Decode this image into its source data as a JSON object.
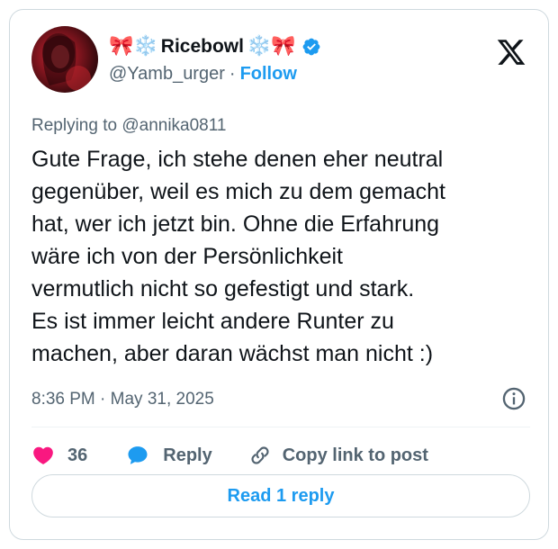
{
  "author": {
    "name_prefix": "🎀❄️",
    "name": "Ricebowl",
    "name_suffix": "❄️🎀",
    "handle": "@Yamb_urger",
    "follow_label": "Follow",
    "verified": true
  },
  "reply_context": {
    "prefix": "Replying to",
    "mention": "@annika0811"
  },
  "tweet": {
    "text": "Gute Frage, ich stehe denen eher neutral\ngegenüber, weil es mich zu dem gemacht\nhat, wer ich jetzt bin. Ohne die Erfahrung\nwäre ich von der Persönlichkeit\nvermutlich nicht so gefestigt und stark.\nEs ist immer leicht andere Runter zu\nmachen, aber daran wächst man nicht :)",
    "timestamp": "8:36 PM · May 31, 2025"
  },
  "actions": {
    "like_count": "36",
    "reply_label": "Reply",
    "copy_label": "Copy link to post"
  },
  "footer": {
    "read_replies_label": "Read 1 reply"
  },
  "colors": {
    "accent": "#1d9bf0",
    "like": "#f91880",
    "text": "#0f1419",
    "muted": "#536471"
  },
  "icons": {
    "platform_logo": "x-logo-icon",
    "verified": "verified-badge-icon",
    "info": "info-icon",
    "like": "heart-icon",
    "reply": "reply-bubble-icon",
    "copy": "link-icon"
  }
}
